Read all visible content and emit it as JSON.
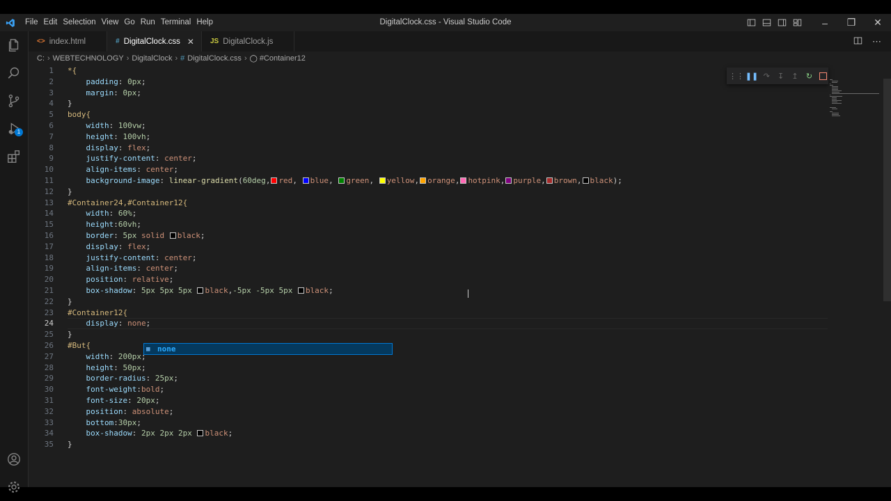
{
  "window": {
    "title": "DigitalClock.css - Visual Studio Code",
    "menu": [
      "File",
      "Edit",
      "Selection",
      "View",
      "Go",
      "Run",
      "Terminal",
      "Help"
    ]
  },
  "tabs": [
    {
      "label": "index.html",
      "icon": "<>",
      "icon_color": "#e37933",
      "active": false
    },
    {
      "label": "DigitalClock.css",
      "icon": "#",
      "icon_color": "#519aba",
      "active": true
    },
    {
      "label": "DigitalClock.js",
      "icon": "JS",
      "icon_color": "#cbcb41",
      "active": false
    }
  ],
  "breadcrumb": {
    "drive": "C:",
    "folder1": "WEBTECHNOLOGY",
    "folder2": "DigitalClock",
    "file": "DigitalClock.css",
    "symbol": "#Container12"
  },
  "editor": {
    "current_line": 24,
    "line_numbers": [
      "1",
      "2",
      "3",
      "4",
      "5",
      "6",
      "7",
      "8",
      "9",
      "10",
      "11",
      "12",
      "13",
      "14",
      "15",
      "16",
      "17",
      "18",
      "19",
      "20",
      "21",
      "22",
      "23",
      "24",
      "25",
      "26",
      "27",
      "28",
      "29",
      "30",
      "31",
      "32",
      "33",
      "34",
      "35"
    ]
  },
  "code": {
    "l1": "*{",
    "l2_p": "padding",
    "l2_v": "0px",
    "l3_p": "margin",
    "l3_v": "0px",
    "l4": "}",
    "l5": "body{",
    "l6_p": "width",
    "l6_v": "100vw",
    "l7_p": "height",
    "l7_v": "100vh",
    "l8_p": "display",
    "l8_v": "flex",
    "l9_p": "justify-content",
    "l9_v": "center",
    "l10_p": "align-items",
    "l10_v": "center",
    "l11_p": "background-image",
    "l11_fn": "linear-gradient",
    "l11_deg": "60deg",
    "l11_colors": [
      "red",
      "blue",
      "green",
      "yellow",
      "orange",
      "hotpink",
      "purple",
      "brown",
      "black"
    ],
    "l12": "}",
    "l13": "#Container24,#Container12{",
    "l14_p": "width",
    "l14_v": "60%",
    "l15_p": "height",
    "l15_v": "60vh",
    "l16_p": "border",
    "l16_v1": "5px",
    "l16_v2": "solid",
    "l16_c": "black",
    "l17_p": "display",
    "l17_v": "flex",
    "l18_p": "justify-content",
    "l18_v": "center",
    "l19_p": "align-items",
    "l19_v": "center",
    "l20_p": "position",
    "l20_v": "relative",
    "l21_p": "box-shadow",
    "l21_v1": "5px 5px 5px",
    "l21_c1": "black",
    "l21_v2": "-5px -5px 5px",
    "l21_c2": "black",
    "l22": "}",
    "l23": "#Container12{",
    "l24_p": "display",
    "l24_v": "none",
    "l25": "}",
    "l26": "#But{",
    "l27_p": "width",
    "l27_v": "200px",
    "l28_p": "height",
    "l28_v": "50px",
    "l29_p": "border-radius",
    "l29_v": "25px",
    "l30_p": "font-weight",
    "l30_v": "bold",
    "l31_p": "font-size",
    "l31_v": "20px",
    "l32_p": "position",
    "l32_v": "absolute",
    "l33_p": "bottom",
    "l33_v": "30px",
    "l34_p": "box-shadow",
    "l34_v": "2px 2px 2px",
    "l34_c": "black",
    "l35": "}"
  },
  "swatches": {
    "red": "#ff0000",
    "blue": "#0000ff",
    "green": "#008000",
    "yellow": "#ffff00",
    "orange": "#ffa500",
    "hotpink": "#ff69b4",
    "purple": "#800080",
    "brown": "#a52a2a",
    "black": "#000000"
  },
  "suggest": {
    "item": "none"
  },
  "activity_badge": "1",
  "colors": {
    "accent": "#0078d4"
  }
}
